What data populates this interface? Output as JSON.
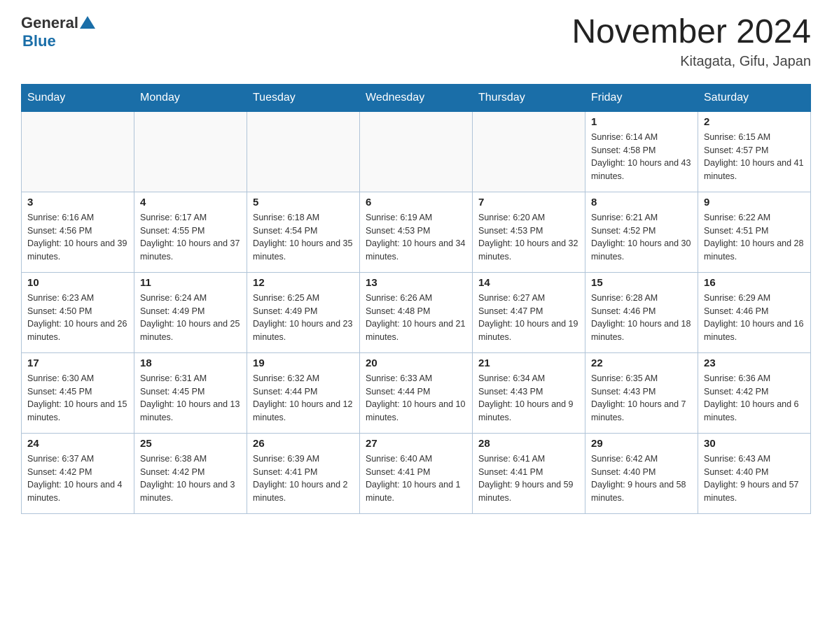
{
  "header": {
    "logo_general": "General",
    "logo_blue": "Blue",
    "month_title": "November 2024",
    "location": "Kitagata, Gifu, Japan"
  },
  "weekdays": [
    "Sunday",
    "Monday",
    "Tuesday",
    "Wednesday",
    "Thursday",
    "Friday",
    "Saturday"
  ],
  "weeks": [
    [
      {
        "day": "",
        "info": ""
      },
      {
        "day": "",
        "info": ""
      },
      {
        "day": "",
        "info": ""
      },
      {
        "day": "",
        "info": ""
      },
      {
        "day": "",
        "info": ""
      },
      {
        "day": "1",
        "info": "Sunrise: 6:14 AM\nSunset: 4:58 PM\nDaylight: 10 hours and 43 minutes."
      },
      {
        "day": "2",
        "info": "Sunrise: 6:15 AM\nSunset: 4:57 PM\nDaylight: 10 hours and 41 minutes."
      }
    ],
    [
      {
        "day": "3",
        "info": "Sunrise: 6:16 AM\nSunset: 4:56 PM\nDaylight: 10 hours and 39 minutes."
      },
      {
        "day": "4",
        "info": "Sunrise: 6:17 AM\nSunset: 4:55 PM\nDaylight: 10 hours and 37 minutes."
      },
      {
        "day": "5",
        "info": "Sunrise: 6:18 AM\nSunset: 4:54 PM\nDaylight: 10 hours and 35 minutes."
      },
      {
        "day": "6",
        "info": "Sunrise: 6:19 AM\nSunset: 4:53 PM\nDaylight: 10 hours and 34 minutes."
      },
      {
        "day": "7",
        "info": "Sunrise: 6:20 AM\nSunset: 4:53 PM\nDaylight: 10 hours and 32 minutes."
      },
      {
        "day": "8",
        "info": "Sunrise: 6:21 AM\nSunset: 4:52 PM\nDaylight: 10 hours and 30 minutes."
      },
      {
        "day": "9",
        "info": "Sunrise: 6:22 AM\nSunset: 4:51 PM\nDaylight: 10 hours and 28 minutes."
      }
    ],
    [
      {
        "day": "10",
        "info": "Sunrise: 6:23 AM\nSunset: 4:50 PM\nDaylight: 10 hours and 26 minutes."
      },
      {
        "day": "11",
        "info": "Sunrise: 6:24 AM\nSunset: 4:49 PM\nDaylight: 10 hours and 25 minutes."
      },
      {
        "day": "12",
        "info": "Sunrise: 6:25 AM\nSunset: 4:49 PM\nDaylight: 10 hours and 23 minutes."
      },
      {
        "day": "13",
        "info": "Sunrise: 6:26 AM\nSunset: 4:48 PM\nDaylight: 10 hours and 21 minutes."
      },
      {
        "day": "14",
        "info": "Sunrise: 6:27 AM\nSunset: 4:47 PM\nDaylight: 10 hours and 19 minutes."
      },
      {
        "day": "15",
        "info": "Sunrise: 6:28 AM\nSunset: 4:46 PM\nDaylight: 10 hours and 18 minutes."
      },
      {
        "day": "16",
        "info": "Sunrise: 6:29 AM\nSunset: 4:46 PM\nDaylight: 10 hours and 16 minutes."
      }
    ],
    [
      {
        "day": "17",
        "info": "Sunrise: 6:30 AM\nSunset: 4:45 PM\nDaylight: 10 hours and 15 minutes."
      },
      {
        "day": "18",
        "info": "Sunrise: 6:31 AM\nSunset: 4:45 PM\nDaylight: 10 hours and 13 minutes."
      },
      {
        "day": "19",
        "info": "Sunrise: 6:32 AM\nSunset: 4:44 PM\nDaylight: 10 hours and 12 minutes."
      },
      {
        "day": "20",
        "info": "Sunrise: 6:33 AM\nSunset: 4:44 PM\nDaylight: 10 hours and 10 minutes."
      },
      {
        "day": "21",
        "info": "Sunrise: 6:34 AM\nSunset: 4:43 PM\nDaylight: 10 hours and 9 minutes."
      },
      {
        "day": "22",
        "info": "Sunrise: 6:35 AM\nSunset: 4:43 PM\nDaylight: 10 hours and 7 minutes."
      },
      {
        "day": "23",
        "info": "Sunrise: 6:36 AM\nSunset: 4:42 PM\nDaylight: 10 hours and 6 minutes."
      }
    ],
    [
      {
        "day": "24",
        "info": "Sunrise: 6:37 AM\nSunset: 4:42 PM\nDaylight: 10 hours and 4 minutes."
      },
      {
        "day": "25",
        "info": "Sunrise: 6:38 AM\nSunset: 4:42 PM\nDaylight: 10 hours and 3 minutes."
      },
      {
        "day": "26",
        "info": "Sunrise: 6:39 AM\nSunset: 4:41 PM\nDaylight: 10 hours and 2 minutes."
      },
      {
        "day": "27",
        "info": "Sunrise: 6:40 AM\nSunset: 4:41 PM\nDaylight: 10 hours and 1 minute."
      },
      {
        "day": "28",
        "info": "Sunrise: 6:41 AM\nSunset: 4:41 PM\nDaylight: 9 hours and 59 minutes."
      },
      {
        "day": "29",
        "info": "Sunrise: 6:42 AM\nSunset: 4:40 PM\nDaylight: 9 hours and 58 minutes."
      },
      {
        "day": "30",
        "info": "Sunrise: 6:43 AM\nSunset: 4:40 PM\nDaylight: 9 hours and 57 minutes."
      }
    ]
  ]
}
